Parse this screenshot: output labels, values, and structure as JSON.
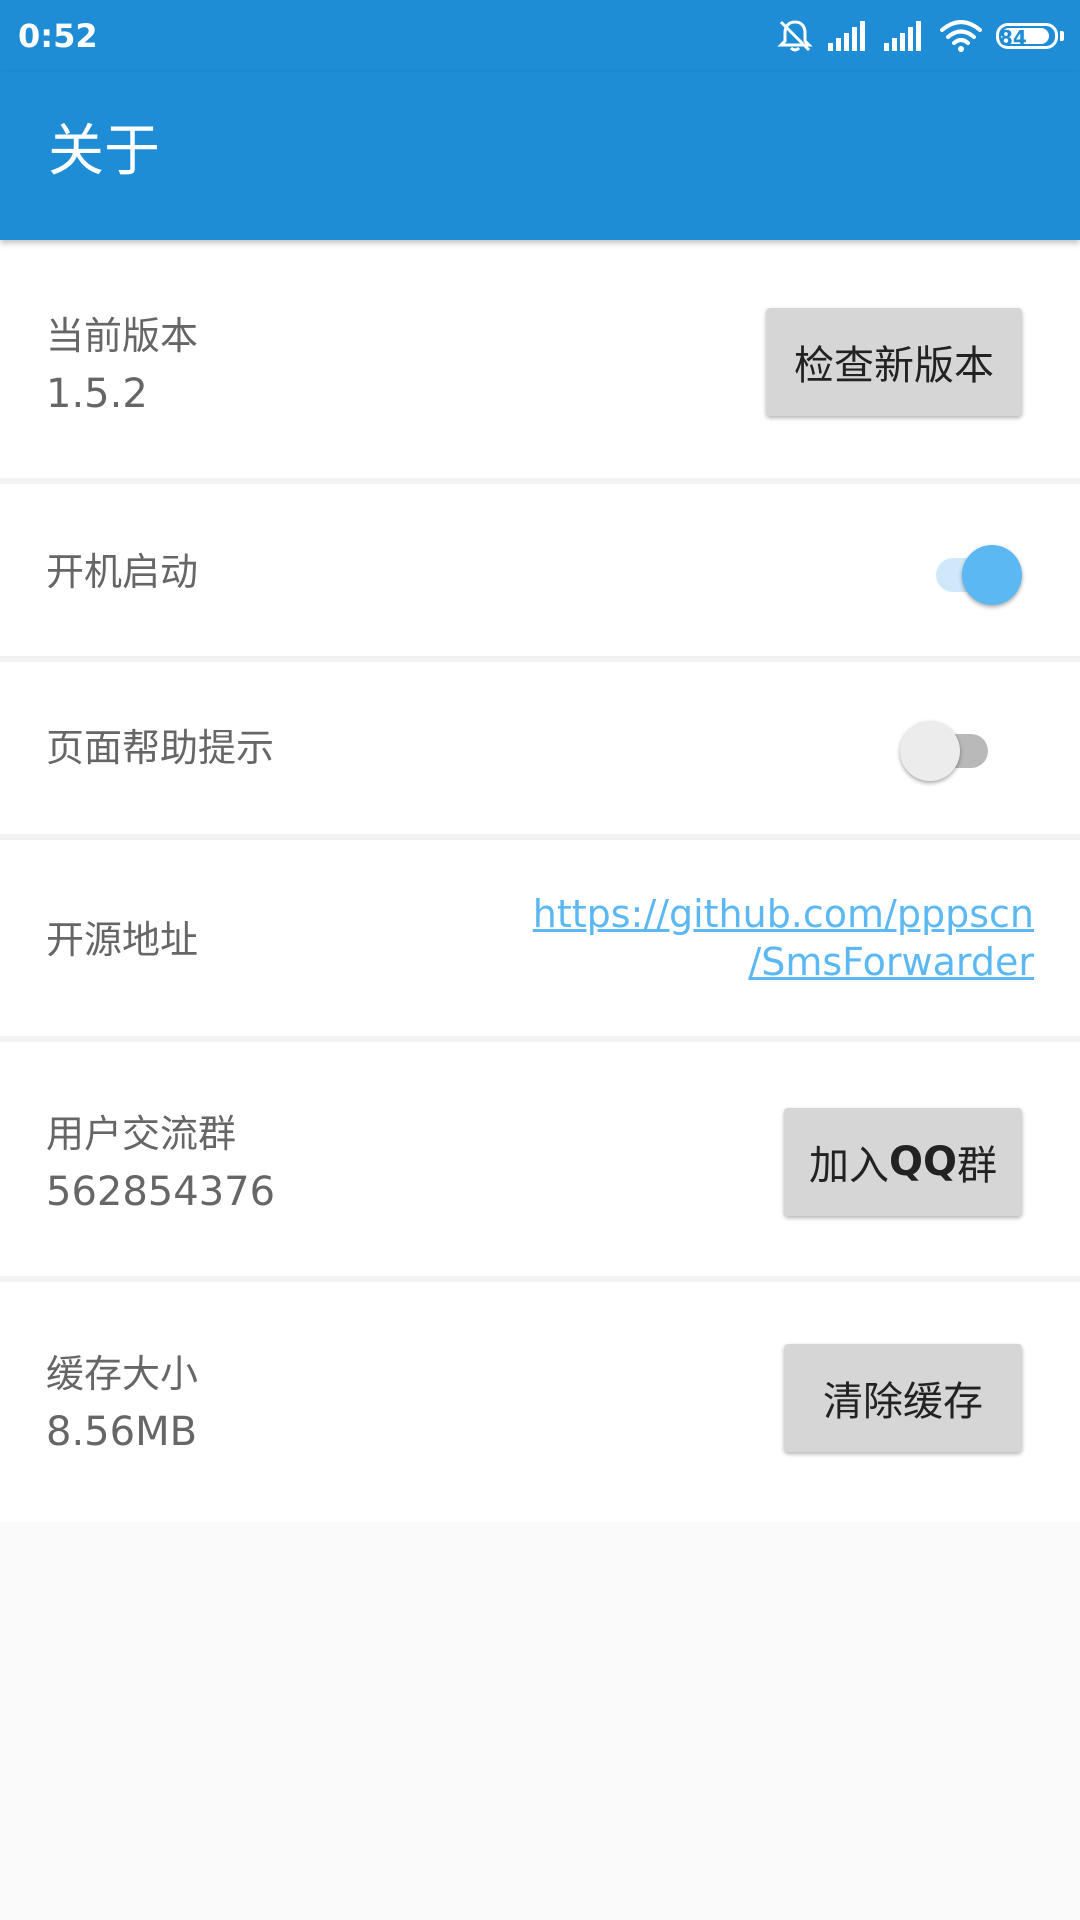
{
  "status_bar": {
    "time": "0:52",
    "battery": "84",
    "icons": [
      "bell-muted-icon",
      "signal-icon",
      "signal-icon",
      "wifi-icon",
      "battery-icon"
    ]
  },
  "app_bar": {
    "title": "关于"
  },
  "rows": {
    "version": {
      "label": "当前版本",
      "value": "1.5.2",
      "button": "检查新版本"
    },
    "autostart": {
      "label": "开机启动",
      "switch_on": true
    },
    "help_tips": {
      "label": "页面帮助提示",
      "switch_on": false
    },
    "source": {
      "label": "开源地址",
      "link_line1": "https://github.com/pppscn",
      "link_line2": "/SmsForwarder"
    },
    "group": {
      "label": "用户交流群",
      "value": "562854376",
      "button_prefix": "加入",
      "button_bold": "QQ",
      "button_suffix": "群"
    },
    "cache": {
      "label": "缓存大小",
      "value": "8.56MB",
      "button": "清除缓存"
    }
  },
  "colors": {
    "primary": "#1f8dd6",
    "accent": "#5cb8f2",
    "background": "#fafafa",
    "button": "#d6d6d6"
  }
}
